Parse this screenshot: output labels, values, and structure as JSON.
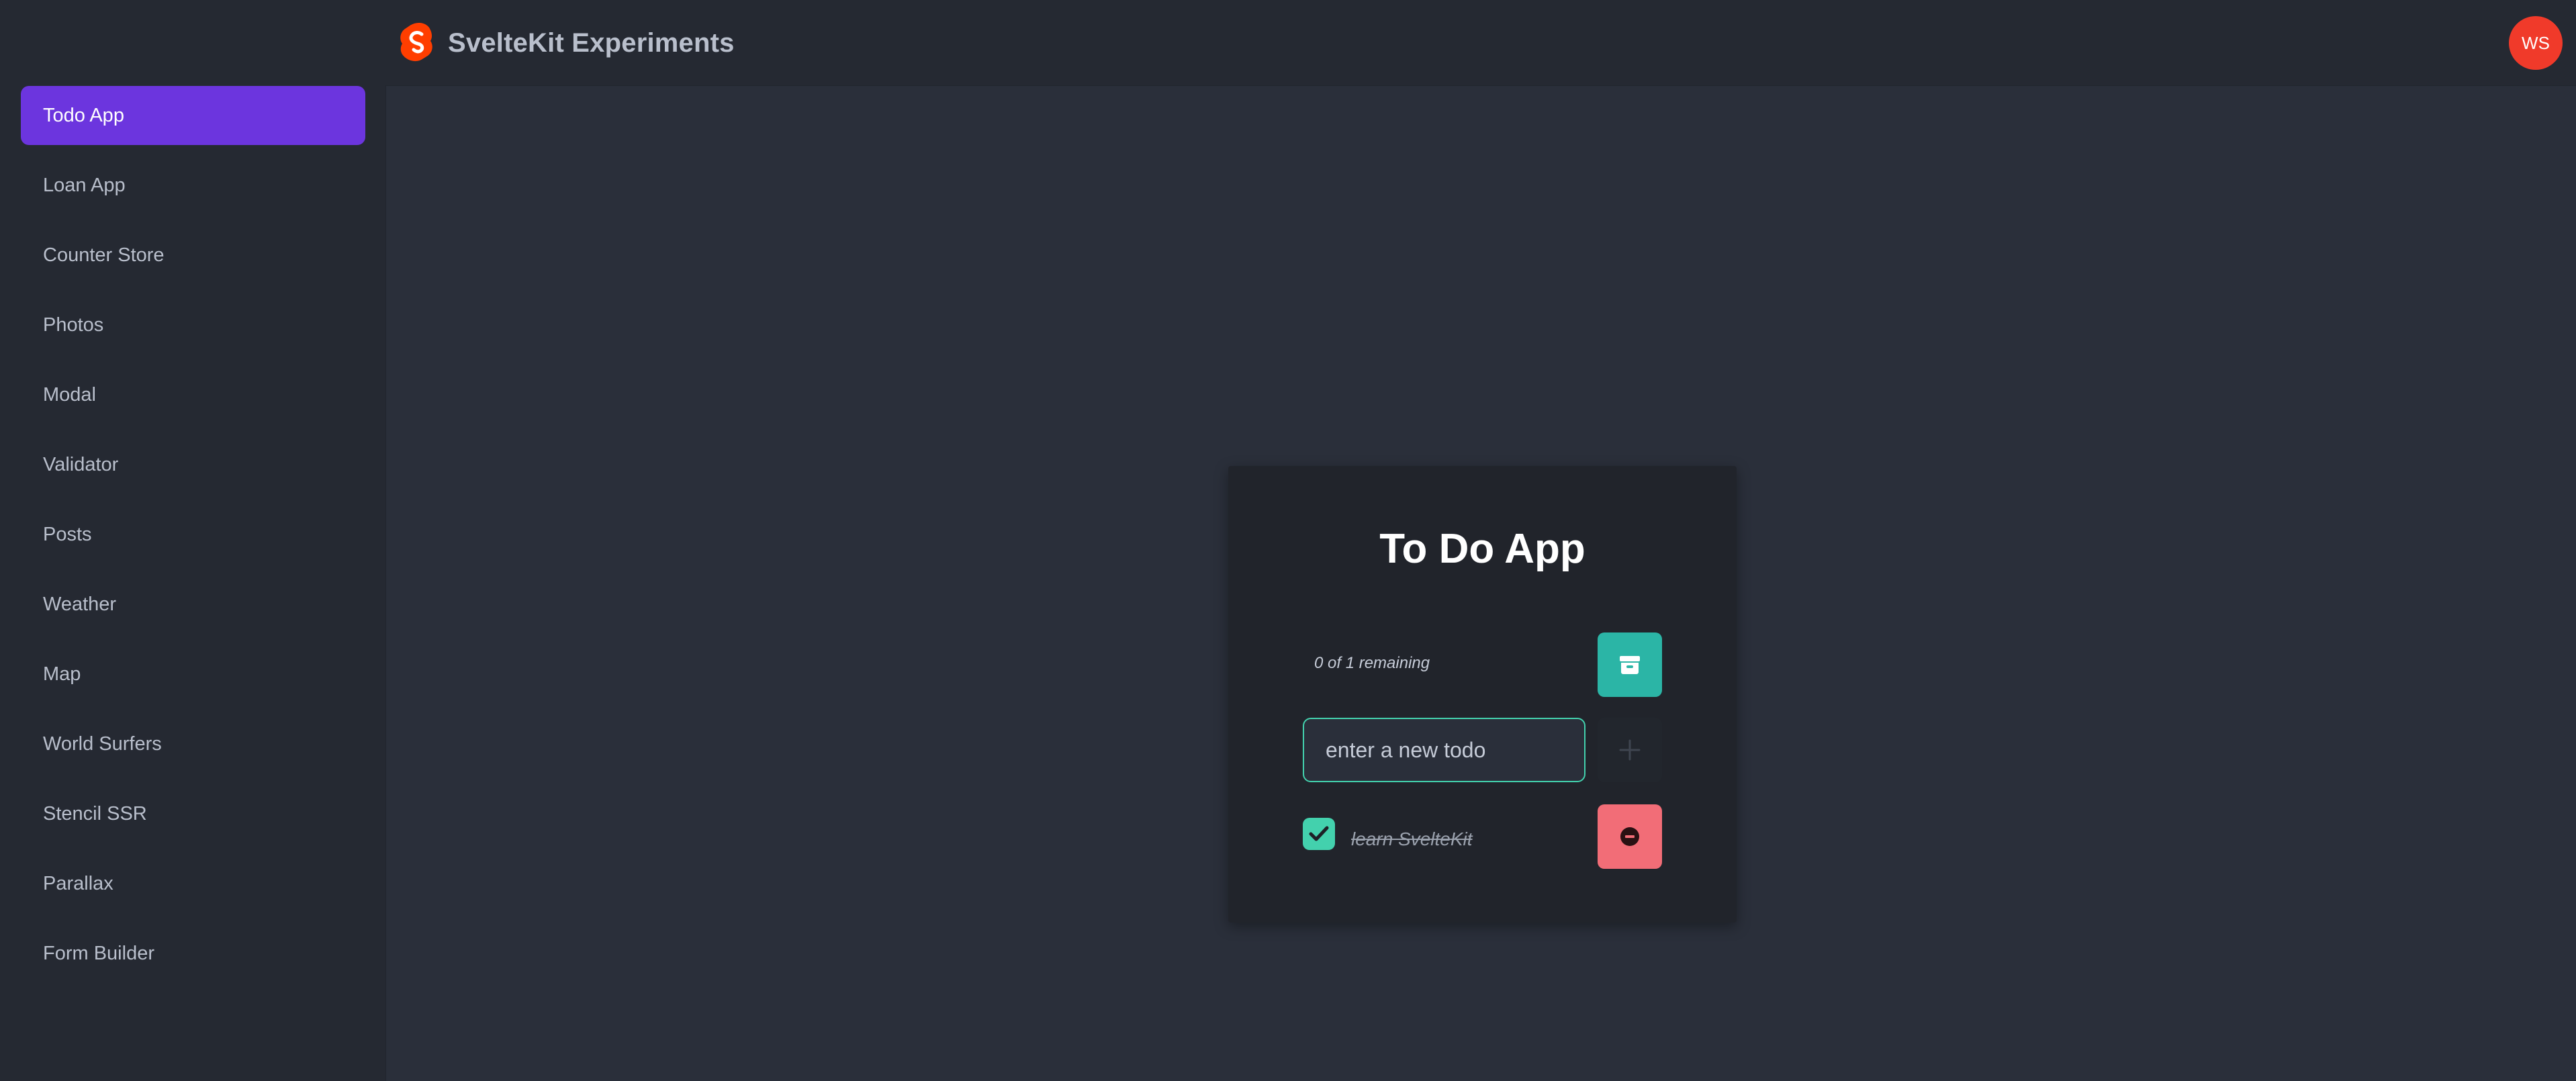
{
  "header": {
    "title": "SvelteKit Experiments",
    "logo_icon": "svelte-logo-icon",
    "avatar_initials": "WS",
    "colors": {
      "logo": "#ff3e00",
      "avatar": "#f03a2a"
    }
  },
  "sidebar": {
    "active_index": 0,
    "active_color": "#6c35de",
    "items": [
      {
        "label": "Todo App"
      },
      {
        "label": "Loan App"
      },
      {
        "label": "Counter Store"
      },
      {
        "label": "Photos"
      },
      {
        "label": "Modal"
      },
      {
        "label": "Validator"
      },
      {
        "label": "Posts"
      },
      {
        "label": "Weather"
      },
      {
        "label": "Map"
      },
      {
        "label": "World Surfers"
      },
      {
        "label": "Stencil SSR"
      },
      {
        "label": "Parallax"
      },
      {
        "label": "Form Builder"
      }
    ]
  },
  "todo": {
    "title": "To Do App",
    "remaining_text": "0 of 1 remaining",
    "input": {
      "value": "",
      "placeholder": "enter a new todo"
    },
    "buttons": {
      "archive_icon": "archive-icon",
      "add_icon": "plus-icon",
      "delete_icon": "minus-circle-icon"
    },
    "items": [
      {
        "text": "learn SvelteKit",
        "done": true
      }
    ],
    "colors": {
      "archive": "#2bb5a6",
      "delete": "#f26d77",
      "accent": "#43d1ad"
    }
  }
}
